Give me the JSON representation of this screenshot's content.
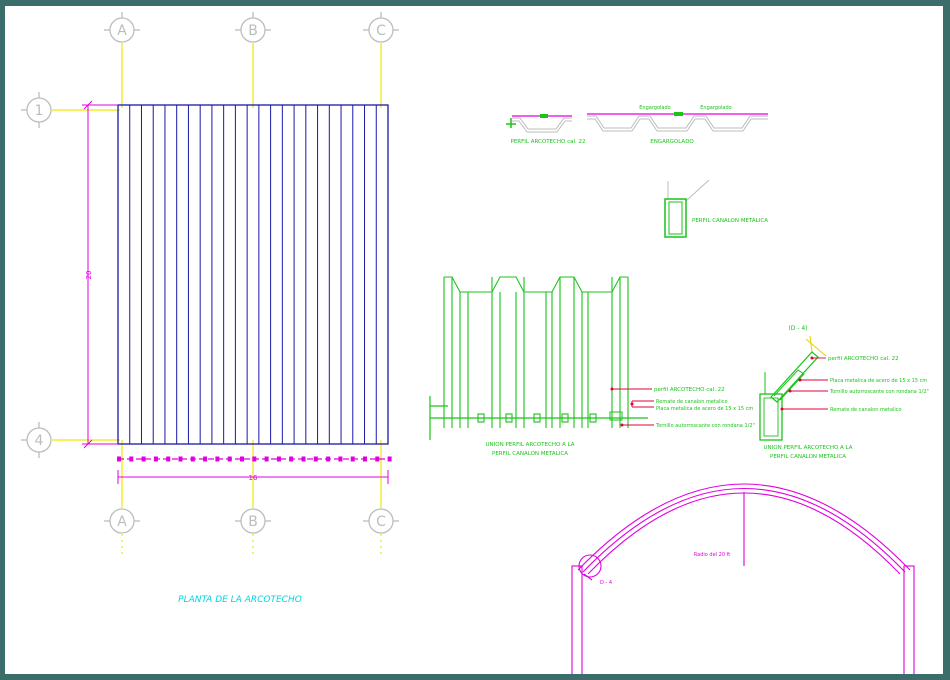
{
  "colors": {
    "background_frame": "#3b6e6a",
    "sheet": "#ffffff",
    "grid_bubble": "#bdbdbd",
    "grid_line": "#f2e600",
    "dimension": "#e000e0",
    "panel": "#1a1aa8",
    "detail": "#19c419",
    "callout": "#e0003a",
    "label_cyan": "#00d6e0"
  },
  "grid": {
    "columns": [
      "A",
      "B",
      "C"
    ],
    "rows": [
      "1",
      "4"
    ]
  },
  "plan": {
    "title": "PLANTA DE LA ARCOTECHO",
    "dim_vertical": "20",
    "dim_horizontal": "16"
  },
  "profiles": {
    "profile_label": "PERFIL ARCOTECHO cal. 22",
    "assembly_label": "ENGARGOLADO",
    "fold_mark_1": "Engargolado",
    "fold_mark_2": "Engargolado",
    "gutter_label": "PERFIL CANALON METALICA"
  },
  "detail_a": {
    "callouts": [
      "perfil ARCOTECHO cal. 22",
      "Remate de canalon metalico",
      "Placa metalica de acero de 15 x 15 cm",
      "Tornillo autorroscante con rondana 1/2\""
    ],
    "title_line1": "UNION PERFIL ARCOTECHO A LA",
    "title_line2": "PERFIL CANALON METALICA"
  },
  "detail_b": {
    "tag": "(D - 4)",
    "callouts": [
      "perfil ARCOTECHO cal. 22",
      "Placa metalica de acero de 15 x 15 cm",
      "Tornillo autorroscante con rondana 1/2\"",
      "Remate de canalon metalico"
    ],
    "title_line1": "UNION PERFIL ARCOTECHO A LA",
    "title_line2": "PERFIL CANALON METALICA"
  },
  "elevation": {
    "radius_label": "Radio del 20 ft",
    "detail_tag": "D - 4"
  }
}
